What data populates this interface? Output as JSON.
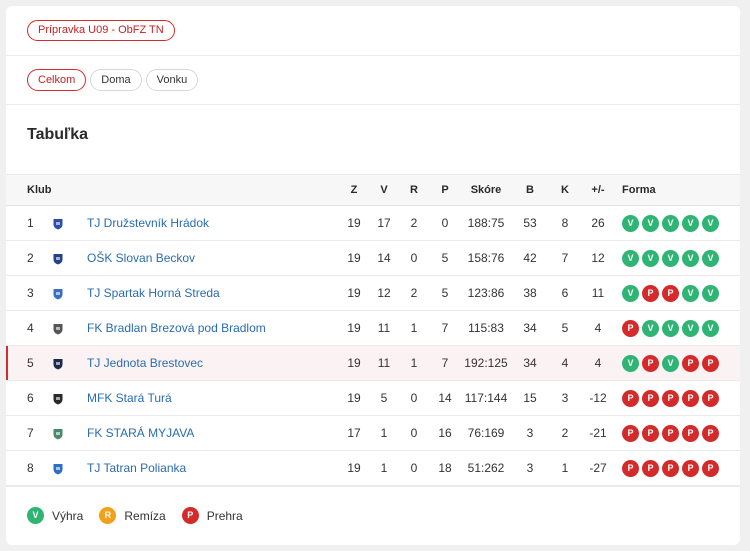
{
  "competition": "Prípravka U09 - ObFZ TN",
  "tabs": [
    {
      "label": "Celkom",
      "active": true
    },
    {
      "label": "Doma",
      "active": false
    },
    {
      "label": "Vonku",
      "active": false
    }
  ],
  "title": "Tabuľka",
  "columns": {
    "klub": "Klub",
    "z": "Z",
    "v": "V",
    "r": "R",
    "p": "P",
    "skore": "Skóre",
    "b": "B",
    "k": "K",
    "diff": "+/-",
    "forma": "Forma"
  },
  "rows": [
    {
      "pos": "1",
      "club": "TJ Družstevník Hrádok",
      "z": "19",
      "v": "17",
      "r": "2",
      "p": "0",
      "skore": "188:75",
      "b": "53",
      "k": "8",
      "diff": "26",
      "form": [
        "V",
        "V",
        "V",
        "V",
        "V"
      ],
      "highlight": false,
      "logo_color": "#2b4ea6"
    },
    {
      "pos": "2",
      "club": "OŠK Slovan Beckov",
      "z": "19",
      "v": "14",
      "r": "0",
      "p": "5",
      "skore": "158:76",
      "b": "42",
      "k": "7",
      "diff": "12",
      "form": [
        "V",
        "V",
        "V",
        "V",
        "V"
      ],
      "highlight": false,
      "logo_color": "#243f8c"
    },
    {
      "pos": "3",
      "club": "TJ Spartak Horná Streda",
      "z": "19",
      "v": "12",
      "r": "2",
      "p": "5",
      "skore": "123:86",
      "b": "38",
      "k": "6",
      "diff": "11",
      "form": [
        "V",
        "P",
        "P",
        "V",
        "V"
      ],
      "highlight": false,
      "logo_color": "#3a6fc4"
    },
    {
      "pos": "4",
      "club": "FK Bradlan Brezová pod Bradlom",
      "z": "19",
      "v": "11",
      "r": "1",
      "p": "7",
      "skore": "115:83",
      "b": "34",
      "k": "5",
      "diff": "4",
      "form": [
        "P",
        "V",
        "V",
        "V",
        "V"
      ],
      "highlight": false,
      "logo_color": "#555555"
    },
    {
      "pos": "5",
      "club": "TJ Jednota Brestovec",
      "z": "19",
      "v": "11",
      "r": "1",
      "p": "7",
      "skore": "192:125",
      "b": "34",
      "k": "4",
      "diff": "4",
      "form": [
        "V",
        "P",
        "V",
        "P",
        "P"
      ],
      "highlight": true,
      "logo_color": "#1e2a4a"
    },
    {
      "pos": "6",
      "club": "MFK Stará Turá",
      "z": "19",
      "v": "5",
      "r": "0",
      "p": "14",
      "skore": "117:144",
      "b": "15",
      "k": "3",
      "diff": "-12",
      "form": [
        "P",
        "P",
        "P",
        "P",
        "P"
      ],
      "highlight": false,
      "logo_color": "#2a2a2a"
    },
    {
      "pos": "7",
      "club": "FK STARÁ MYJAVA",
      "z": "17",
      "v": "1",
      "r": "0",
      "p": "16",
      "skore": "76:169",
      "b": "3",
      "k": "2",
      "diff": "-21",
      "form": [
        "P",
        "P",
        "P",
        "P",
        "P"
      ],
      "highlight": false,
      "logo_color": "#4a8a6a"
    },
    {
      "pos": "8",
      "club": "TJ Tatran Polianka",
      "z": "19",
      "v": "1",
      "r": "0",
      "p": "18",
      "skore": "51:262",
      "b": "3",
      "k": "1",
      "diff": "-27",
      "form": [
        "P",
        "P",
        "P",
        "P",
        "P"
      ],
      "highlight": false,
      "logo_color": "#2d6fc0"
    }
  ],
  "legend": [
    {
      "letter": "V",
      "label": "Výhra"
    },
    {
      "letter": "R",
      "label": "Remíza"
    },
    {
      "letter": "P",
      "label": "Prehra"
    }
  ],
  "colors": {
    "win": "#2fb573",
    "draw": "#f3a11b",
    "loss": "#d42a2a",
    "accent": "#d42a2a",
    "link": "#2a6cb0"
  }
}
